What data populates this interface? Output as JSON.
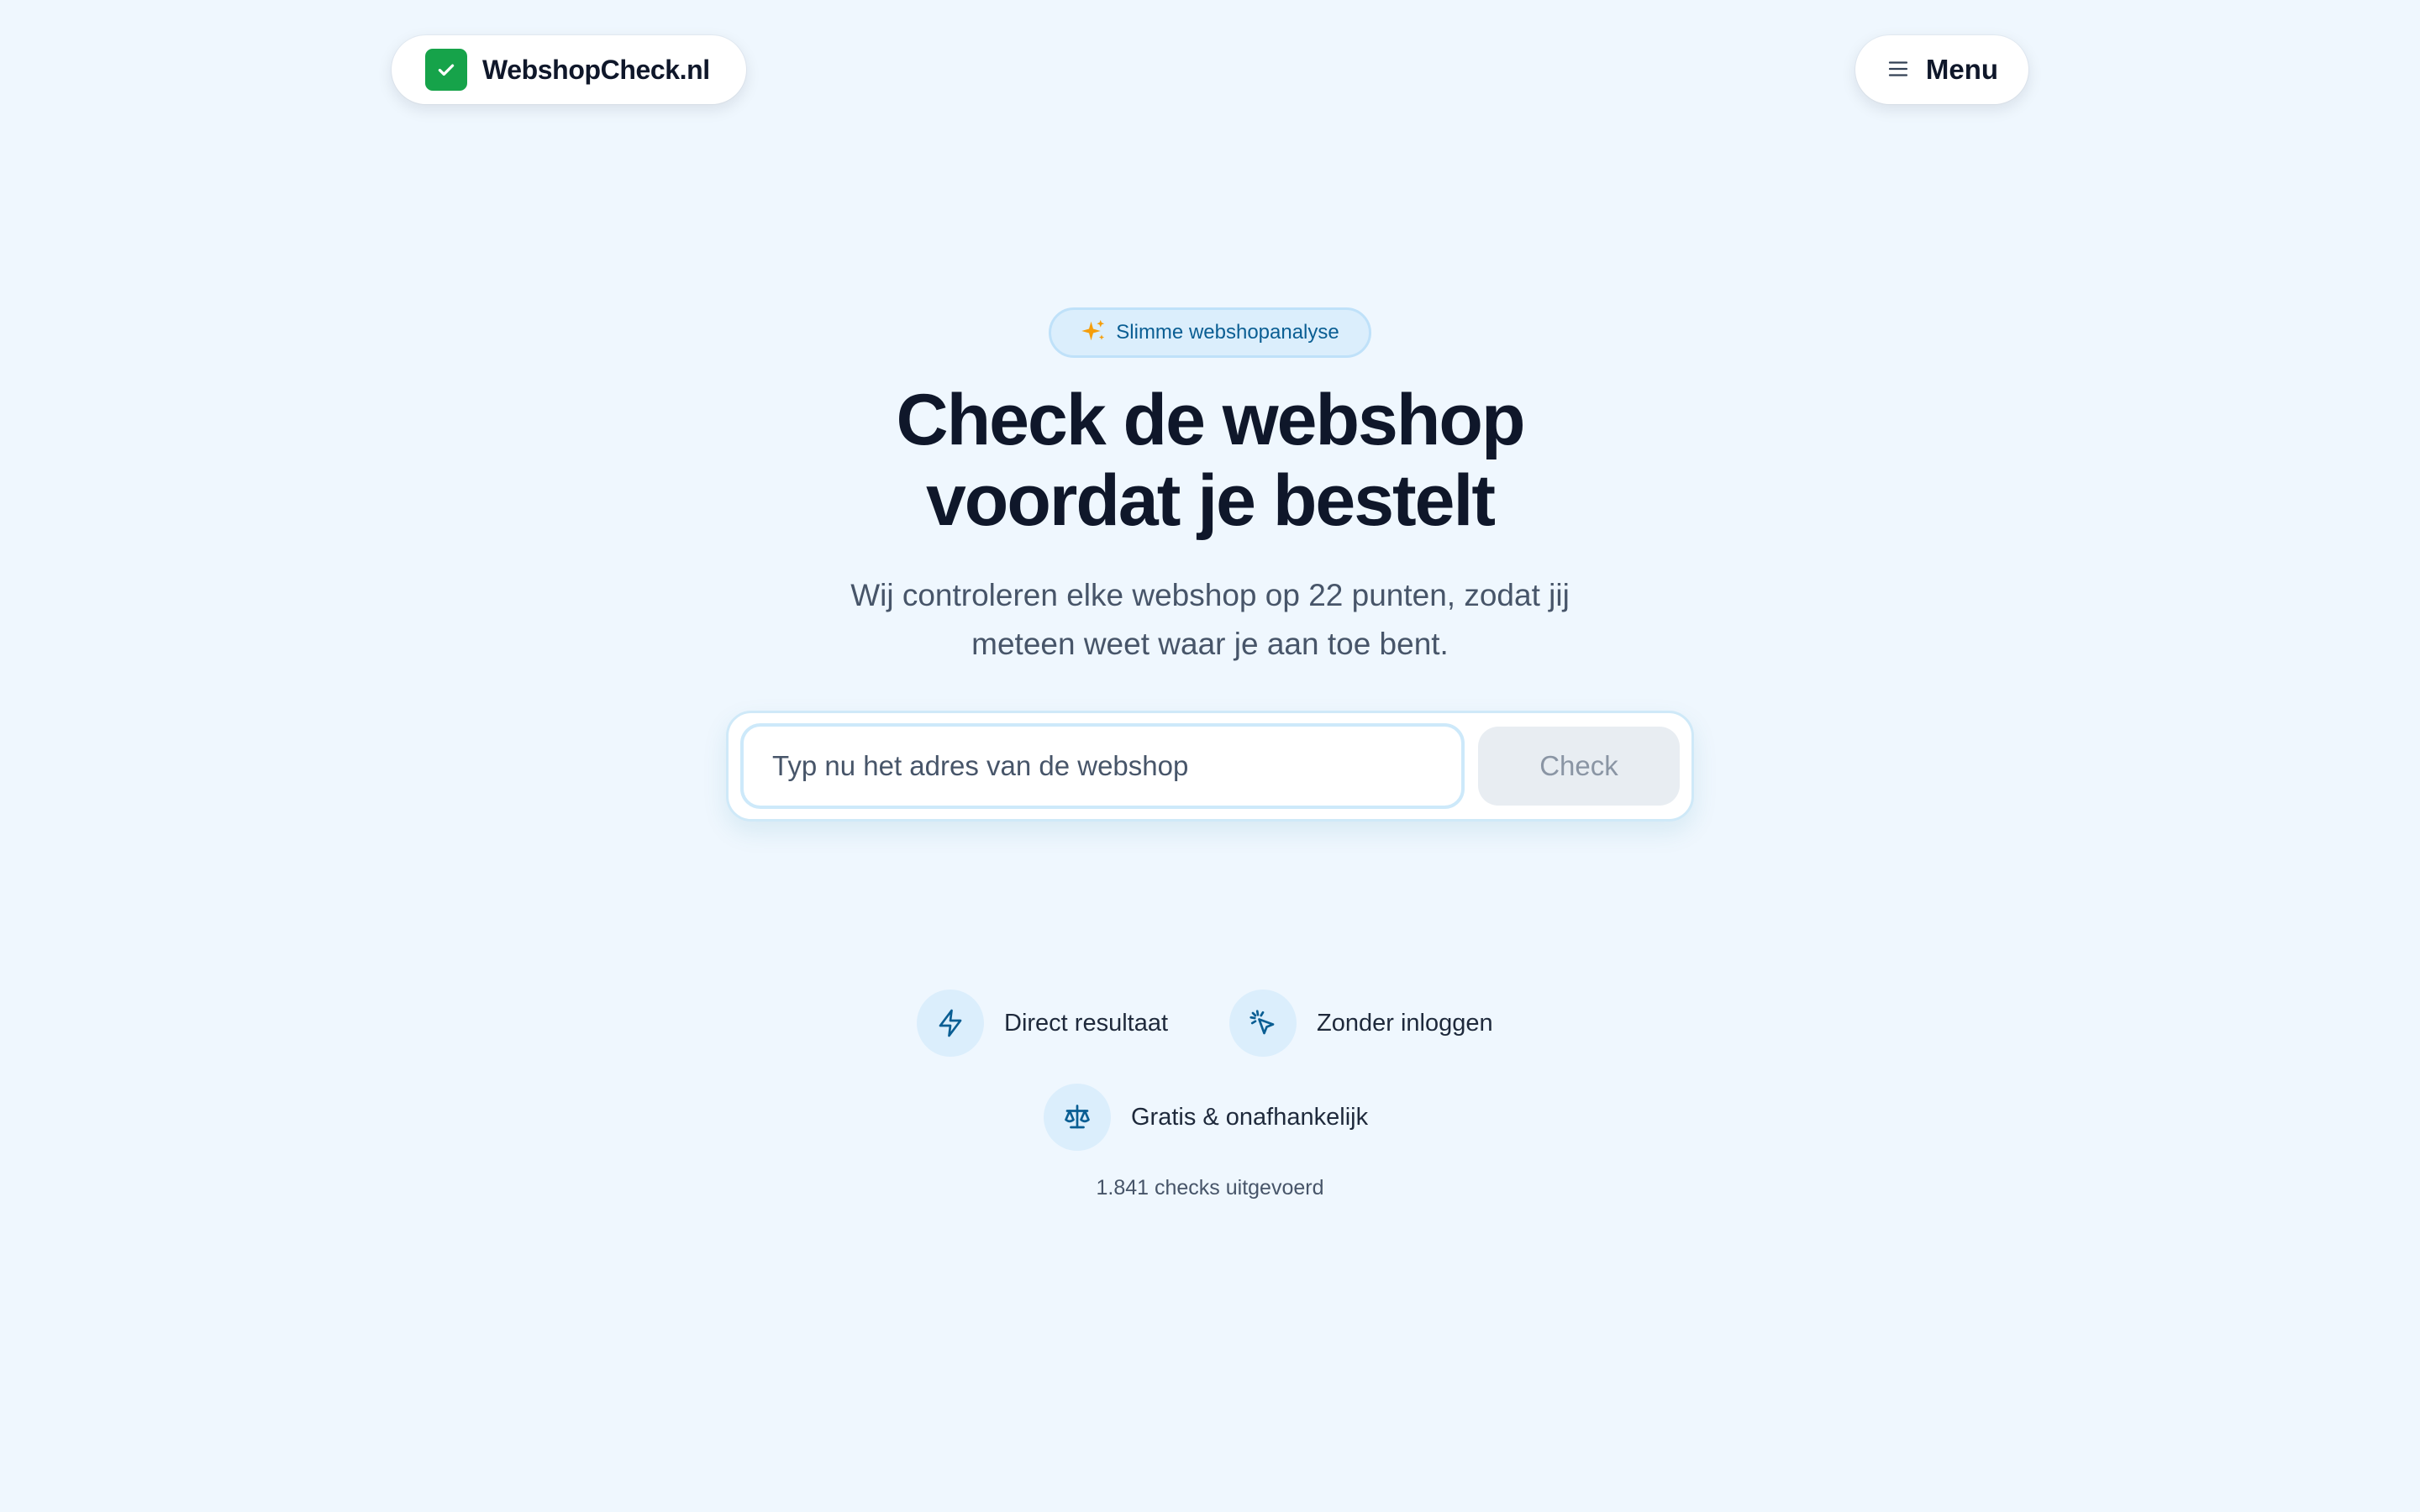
{
  "header": {
    "logo_text": "WebshopCheck.nl",
    "logo_icon": "check-icon",
    "menu_label": "Menu",
    "menu_icon": "hamburger-menu-icon"
  },
  "hero": {
    "badge_text": "Slimme webshopanalyse",
    "badge_icon": "sparkles-icon",
    "title_line1": "Check de webshop",
    "title_line2": "voordat je bestelt",
    "subtitle_line1": "Wij controleren elke webshop op 22 punten, zodat jij",
    "subtitle_line2": "meteen weet waar je aan toe bent."
  },
  "search": {
    "placeholder": "Typ nu het adres van de webshop",
    "value": "",
    "button_label": "Check"
  },
  "features": [
    {
      "label": "Direct resultaat",
      "icon": "lightning-icon"
    },
    {
      "label": "Zonder inloggen",
      "icon": "cursor-click-icon"
    },
    {
      "label": "Gratis & onafhankelijk",
      "icon": "scale-icon"
    }
  ],
  "stats": {
    "checks_text": "1.841 checks uitgevoerd"
  },
  "colors": {
    "background": "#eff7fe",
    "brand_green": "#16a34a",
    "accent_blue": "#0a5e93",
    "title": "#0f172a",
    "muted_text": "#475569"
  }
}
